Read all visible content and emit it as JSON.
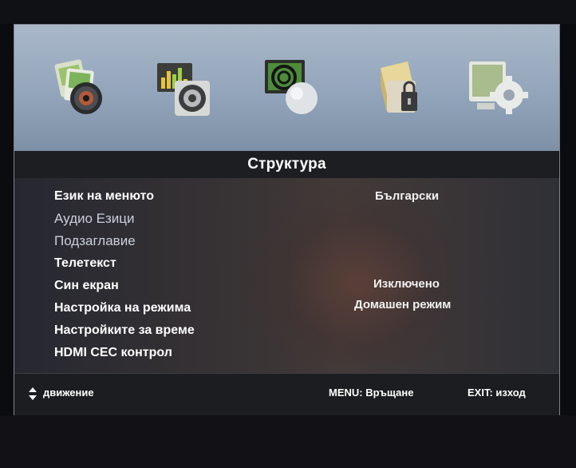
{
  "menu_title": "Структура",
  "menu_icons": [
    "picture-settings-icon",
    "audio-settings-icon",
    "channel-settings-icon",
    "lock-settings-icon",
    "setup-settings-icon"
  ],
  "menu_items": [
    {
      "label": "Език на менюто",
      "value": "Български",
      "state": "selected"
    },
    {
      "label": "Аудио Езици",
      "value": "",
      "state": "dim"
    },
    {
      "label": "Подзаглавие",
      "value": "",
      "state": "dim"
    },
    {
      "label": "Телетекст",
      "value": "",
      "state": "normal"
    },
    {
      "label": "Син екран",
      "value": "Изключено",
      "state": "normal"
    },
    {
      "label": "Настройка на режима",
      "value": "Домашен режим",
      "state": "normal"
    },
    {
      "label": "Настройките за време",
      "value": "",
      "state": "normal"
    },
    {
      "label": "HDMI CEC контрол",
      "value": "",
      "state": "normal"
    }
  ],
  "footer": {
    "move_hint": "движение",
    "menu_hint": "MENU: Връщане",
    "exit_hint": "EXIT: изход"
  },
  "colors": {
    "icon_strip": "#9aaabe",
    "title_bar": "#1d1e22",
    "text": "#ffffff",
    "dim_text": "#c9cfda"
  }
}
